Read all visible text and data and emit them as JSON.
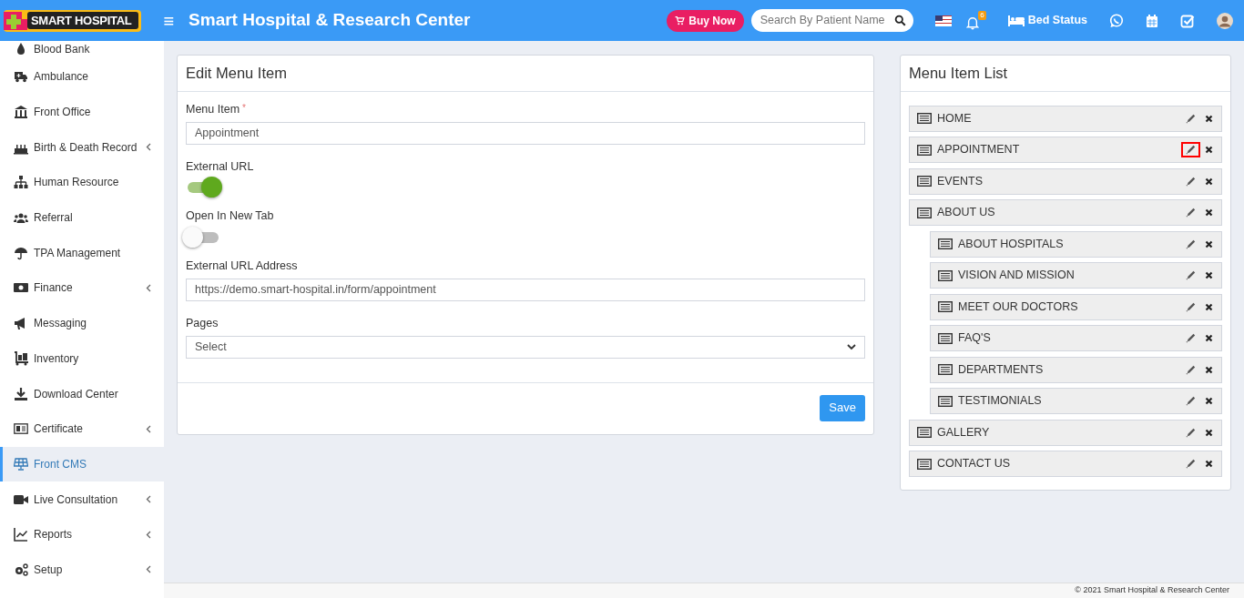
{
  "header": {
    "logo_text": "SMART HOSPITAL",
    "menu_toggle": "≡",
    "title": "Smart Hospital & Research Center",
    "buy_now": "Buy Now",
    "search": {
      "placeholder": "Search By Patient Name"
    },
    "notification_count": "6",
    "bed_status": "Bed Status"
  },
  "sidebar": {
    "items": [
      {
        "label": "Blood Bank",
        "has_submenu": false,
        "selected": false
      },
      {
        "label": "Ambulance",
        "has_submenu": false,
        "selected": false
      },
      {
        "label": "Front Office",
        "has_submenu": false,
        "selected": false
      },
      {
        "label": "Birth & Death Record",
        "has_submenu": true,
        "selected": false
      },
      {
        "label": "Human Resource",
        "has_submenu": false,
        "selected": false
      },
      {
        "label": "Referral",
        "has_submenu": false,
        "selected": false
      },
      {
        "label": "TPA Management",
        "has_submenu": false,
        "selected": false
      },
      {
        "label": "Finance",
        "has_submenu": true,
        "selected": false
      },
      {
        "label": "Messaging",
        "has_submenu": false,
        "selected": false
      },
      {
        "label": "Inventory",
        "has_submenu": false,
        "selected": false
      },
      {
        "label": "Download Center",
        "has_submenu": false,
        "selected": false
      },
      {
        "label": "Certificate",
        "has_submenu": true,
        "selected": false
      },
      {
        "label": "Front CMS",
        "has_submenu": false,
        "selected": true
      },
      {
        "label": "Live Consultation",
        "has_submenu": true,
        "selected": false
      },
      {
        "label": "Reports",
        "has_submenu": true,
        "selected": false
      },
      {
        "label": "Setup",
        "has_submenu": true,
        "selected": false
      }
    ]
  },
  "edit_form": {
    "title": "Edit Menu Item",
    "menu_item": {
      "label": "Menu Item",
      "required_mark": "*",
      "value": "Appointment"
    },
    "external_url": {
      "label": "External URL",
      "on": true
    },
    "open_in_new_tab": {
      "label": "Open In New Tab",
      "on": false
    },
    "external_url_address": {
      "label": "External URL Address",
      "value": "https://demo.smart-hospital.in/form/appointment"
    },
    "pages": {
      "label": "Pages",
      "value": "Select"
    },
    "save": "Save"
  },
  "menu_list": {
    "title": "Menu Item List",
    "items": [
      {
        "label": "HOME",
        "edit_highlighted": false
      },
      {
        "label": "APPOINTMENT",
        "edit_highlighted": true
      },
      {
        "label": "EVENTS",
        "edit_highlighted": false
      },
      {
        "label": "ABOUT US",
        "edit_highlighted": false,
        "children": [
          {
            "label": "ABOUT HOSPITALS",
            "edit_highlighted": false
          },
          {
            "label": "VISION AND MISSION",
            "edit_highlighted": false
          },
          {
            "label": "MEET OUR DOCTORS",
            "edit_highlighted": false
          },
          {
            "label": "FAQ'S",
            "edit_highlighted": false
          },
          {
            "label": "DEPARTMENTS",
            "edit_highlighted": false
          },
          {
            "label": "TESTIMONIALS",
            "edit_highlighted": false
          }
        ]
      },
      {
        "label": "GALLERY",
        "edit_highlighted": false
      },
      {
        "label": "CONTACT US",
        "edit_highlighted": false
      }
    ]
  },
  "footer": "© 2021 Smart Hospital & Research Center"
}
